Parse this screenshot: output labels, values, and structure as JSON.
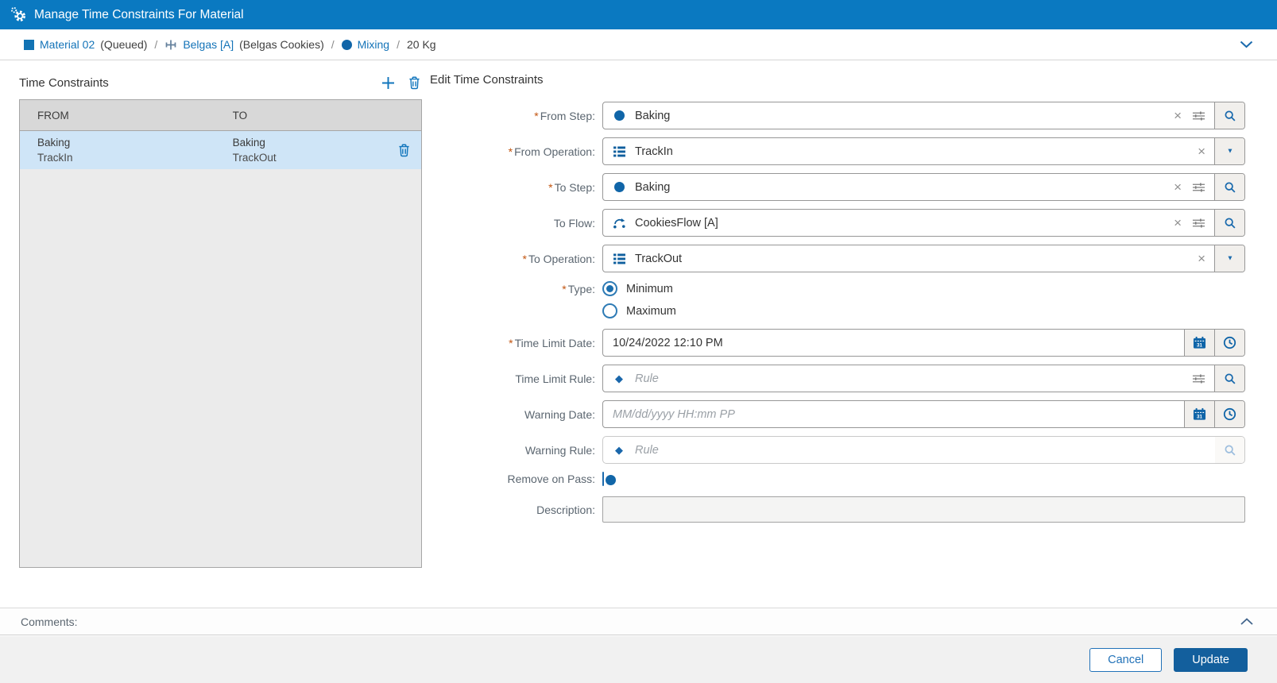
{
  "header": {
    "title": "Manage Time Constraints For Material"
  },
  "breadcrumb": {
    "separator": "/",
    "material": {
      "label": "Material 02",
      "status": "(Queued)"
    },
    "product": {
      "label": "Belgas [A]",
      "description": "(Belgas Cookies)"
    },
    "step": {
      "label": "Mixing"
    },
    "quantity": "20 Kg"
  },
  "left_panel": {
    "title": "Time Constraints",
    "table": {
      "columns": [
        "FROM",
        "TO"
      ],
      "rows": [
        {
          "from_step": "Baking",
          "from_operation": "TrackIn",
          "to_step": "Baking",
          "to_operation": "TrackOut"
        }
      ]
    }
  },
  "form": {
    "title": "Edit Time Constraints",
    "required_marker": "*",
    "fields": {
      "from_step": {
        "label": "From Step:",
        "value": "Baking"
      },
      "from_operation": {
        "label": "From Operation:",
        "value": "TrackIn"
      },
      "to_step": {
        "label": "To Step:",
        "value": "Baking"
      },
      "to_flow": {
        "label": "To Flow:",
        "value": "CookiesFlow [A]"
      },
      "to_operation": {
        "label": "To Operation:",
        "value": "TrackOut"
      },
      "type": {
        "label": "Type:",
        "options": [
          {
            "label": "Minimum",
            "selected": true
          },
          {
            "label": "Maximum",
            "selected": false
          }
        ]
      },
      "time_limit_date": {
        "label": "Time Limit Date:",
        "value": "10/24/2022 12:10 PM"
      },
      "time_limit_rule": {
        "label": "Time Limit Rule:",
        "placeholder": "Rule"
      },
      "warning_date": {
        "label": "Warning Date:",
        "placeholder": "MM/dd/yyyy HH:mm PP"
      },
      "warning_rule": {
        "label": "Warning Rule:",
        "placeholder": "Rule"
      },
      "remove_on_pass": {
        "label": "Remove on Pass:",
        "enabled": false
      },
      "description": {
        "label": "Description:",
        "value": ""
      }
    }
  },
  "comments": {
    "label": "Comments:"
  },
  "footer": {
    "cancel_label": "Cancel",
    "update_label": "Update"
  },
  "icons": {
    "clear_glyph": "×",
    "dropdown_glyph": "▼"
  },
  "colors": {
    "header_bar": "#0a79c1",
    "link_blue": "#1373b8",
    "icon_blue": "#10609f",
    "selected_row": "#cfe5f7",
    "update_button": "#135f9d",
    "required_marker": "#c25510"
  }
}
